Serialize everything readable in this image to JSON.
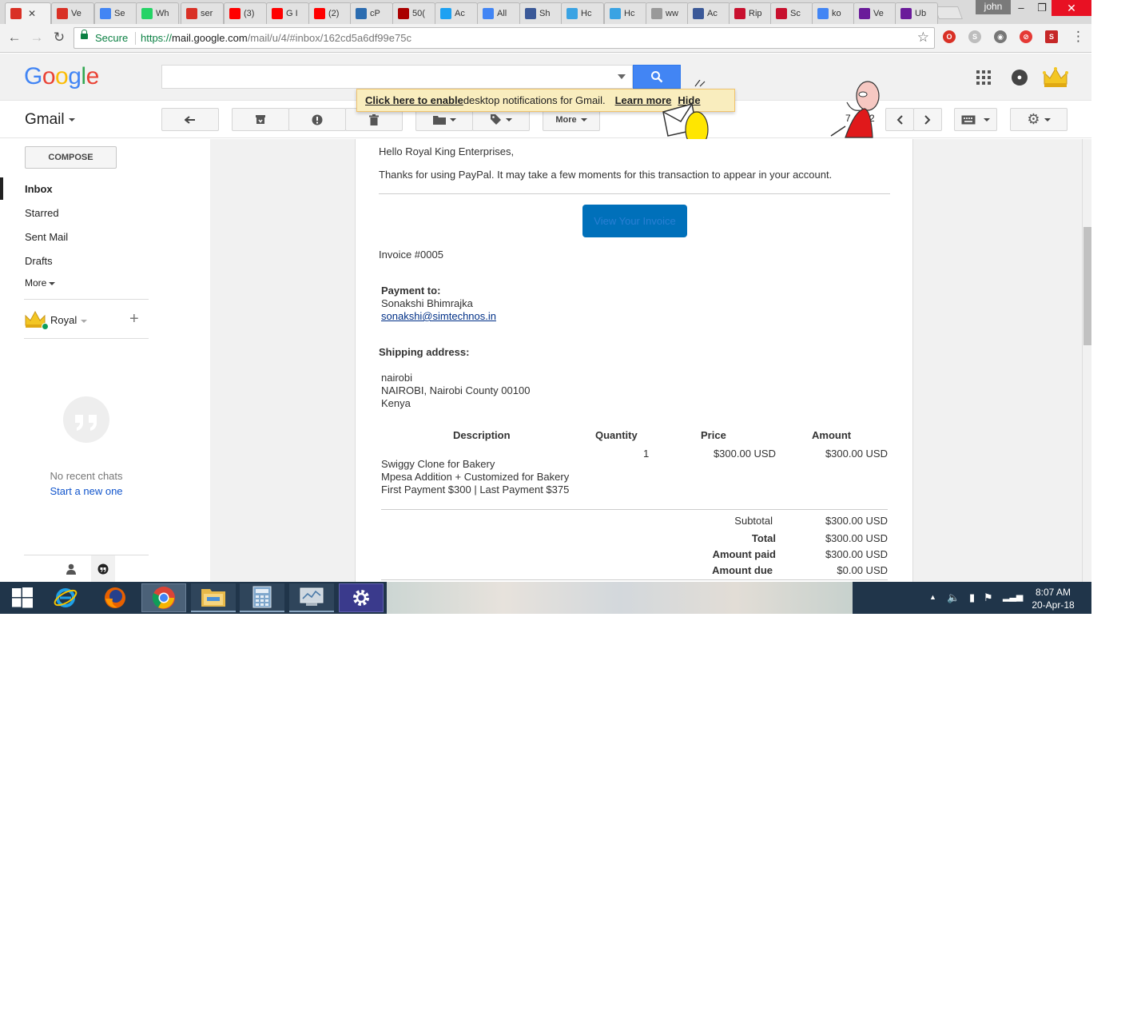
{
  "browser": {
    "tabs": [
      {
        "label": "",
        "icon": "gmail-icon",
        "color": "#d93025"
      },
      {
        "label": "Ve",
        "icon": "gmail-icon",
        "color": "#d93025"
      },
      {
        "label": "Se",
        "icon": "google-icon",
        "color": "#4285f4"
      },
      {
        "label": "Wh",
        "icon": "whatsapp-icon",
        "color": "#25d366"
      },
      {
        "label": "ser",
        "icon": "gmail-icon",
        "color": "#d93025"
      },
      {
        "label": "(3)",
        "icon": "youtube-icon",
        "color": "#ff0000"
      },
      {
        "label": "G I",
        "icon": "youtube-icon",
        "color": "#ff0000"
      },
      {
        "label": "(2)",
        "icon": "youtube-icon",
        "color": "#ff0000"
      },
      {
        "label": "cP",
        "icon": "cpanel-icon",
        "color": "#2b6cb0"
      },
      {
        "label": "50(",
        "icon": "target-icon",
        "color": "#a00"
      },
      {
        "label": "Ac",
        "icon": "twitter-icon",
        "color": "#1da1f2"
      },
      {
        "label": "All",
        "icon": "docs-icon",
        "color": "#4285f4"
      },
      {
        "label": "Sh",
        "icon": "facebook-icon",
        "color": "#3b5998"
      },
      {
        "label": "Hc",
        "icon": "hc-icon",
        "color": "#3aa3e3"
      },
      {
        "label": "Hc",
        "icon": "hc-icon",
        "color": "#3aa3e3"
      },
      {
        "label": "ww",
        "icon": "page-icon",
        "color": "#999999"
      },
      {
        "label": "Ac",
        "icon": "facebook-icon",
        "color": "#3b5998"
      },
      {
        "label": "Rip",
        "icon": "r-icon",
        "color": "#c8102e"
      },
      {
        "label": "Sc",
        "icon": "r-icon",
        "color": "#c8102e"
      },
      {
        "label": "ko",
        "icon": "google-icon",
        "color": "#4285f4"
      },
      {
        "label": "Ve",
        "icon": "ve-icon",
        "color": "#6a1b9a"
      },
      {
        "label": "Ub",
        "icon": "ve-icon",
        "color": "#6a1b9a"
      }
    ],
    "window_user": "john",
    "secure_label": "Secure",
    "url_scheme": "https://",
    "url_host": "mail.google.com",
    "url_path": "/mail/u/4/#inbox/162cd5a6df99e75c"
  },
  "gmail": {
    "logo": "Google",
    "search_value": "",
    "app_label": "Gmail",
    "more_label": "More",
    "pager_text": "7 of 22",
    "notification": {
      "enable_link": "Click here to enable",
      "text": " desktop notifications for Gmail.",
      "learn_more": "Learn more",
      "hide": "Hide"
    }
  },
  "sidebar": {
    "compose": "COMPOSE",
    "items": [
      "Inbox",
      "Starred",
      "Sent Mail",
      "Drafts",
      "More"
    ],
    "account": "Royal",
    "no_chats": "No recent chats",
    "start_new": "Start a new one"
  },
  "email": {
    "greeting": "Hello Royal King Enterprises,",
    "intro": "Thanks for using PayPal. It may take a few moments for this transaction to appear in your account.",
    "view_invoice": "View Your Invoice",
    "invoice_number": "Invoice #0005",
    "payment_to_label": "Payment to:",
    "payee_name": "Sonakshi Bhimrajka",
    "payee_email": "sonakshi@simtechnos.in",
    "shipping_label": "Shipping address:",
    "shipping_lines": [
      "nairobi",
      "NAIROBI, Nairobi County 00100",
      "Kenya"
    ],
    "table": {
      "headers": [
        "Description",
        "Quantity",
        "Price",
        "Amount"
      ],
      "rows": [
        {
          "description": [
            "Swiggy Clone for Bakery",
            "Mpesa Addition + Customized for Bakery",
            "First Payment $300 | Last Payment $375"
          ],
          "quantity": "1",
          "price": "$300.00 USD",
          "amount": "$300.00 USD"
        }
      ]
    },
    "totals": [
      {
        "label": "Subtotal",
        "value": "$300.00 USD"
      },
      {
        "label": "Total",
        "value": "$300.00 USD"
      },
      {
        "label": "Amount paid",
        "value": "$300.00 USD"
      },
      {
        "label": "Amount due",
        "value": "$0.00 USD"
      }
    ]
  },
  "taskbar": {
    "time": "8:07 AM",
    "date": "20-Apr-18"
  }
}
